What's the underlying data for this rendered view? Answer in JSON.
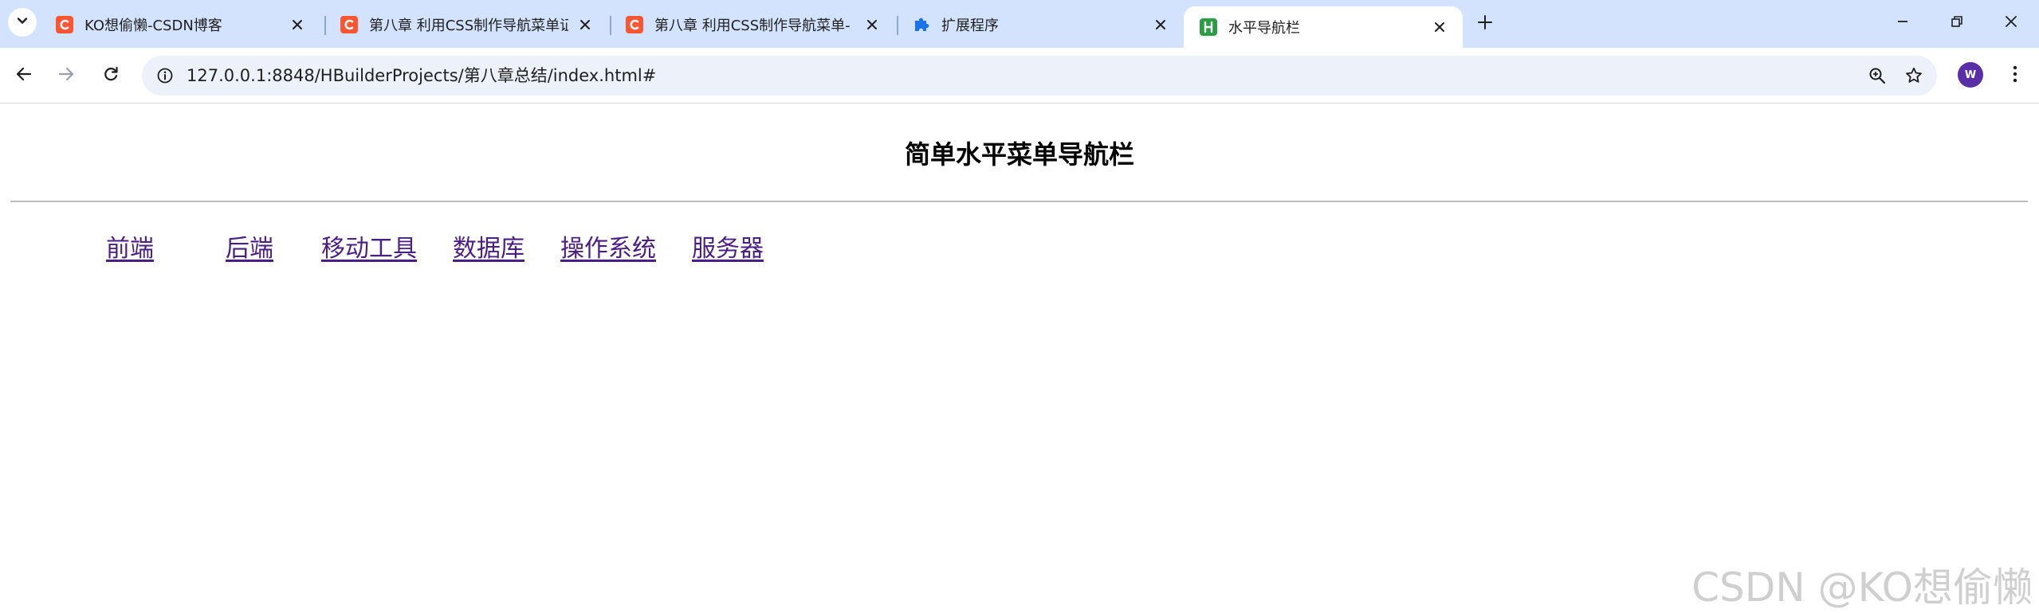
{
  "browser": {
    "tabs": [
      {
        "title": "KO想偷懒-CSDN博客",
        "favicon": "csdn-icon",
        "active": false
      },
      {
        "title": "第八章 利用CSS制作导航菜单证",
        "favicon": "csdn-icon",
        "active": false
      },
      {
        "title": "第八章 利用CSS制作导航菜单-",
        "favicon": "csdn-icon",
        "active": false
      },
      {
        "title": "扩展程序",
        "favicon": "puzzle-icon",
        "active": false
      },
      {
        "title": "水平导航栏",
        "favicon": "hbuilder-icon",
        "active": true
      }
    ],
    "url": "127.0.0.1:8848/HBuilderProjects/第八章总结/index.html#",
    "profile_initial": "W",
    "colors": {
      "tabstrip": "#d3e3fd",
      "omnibox": "#edf2fa",
      "csdn": "#fc5531",
      "hbuilder": "#2a9d45",
      "extensions": "#1a73e8",
      "avatar": "#5a2ea6"
    }
  },
  "page": {
    "heading": "简单水平菜单导航栏",
    "menu": [
      {
        "label": "前端"
      },
      {
        "label": "后端"
      },
      {
        "label": "移动工具"
      },
      {
        "label": "数据库"
      },
      {
        "label": "操作系统"
      },
      {
        "label": "服务器"
      }
    ],
    "link_color": "#4b1e84",
    "watermark": "CSDN @KO想偷懒"
  }
}
